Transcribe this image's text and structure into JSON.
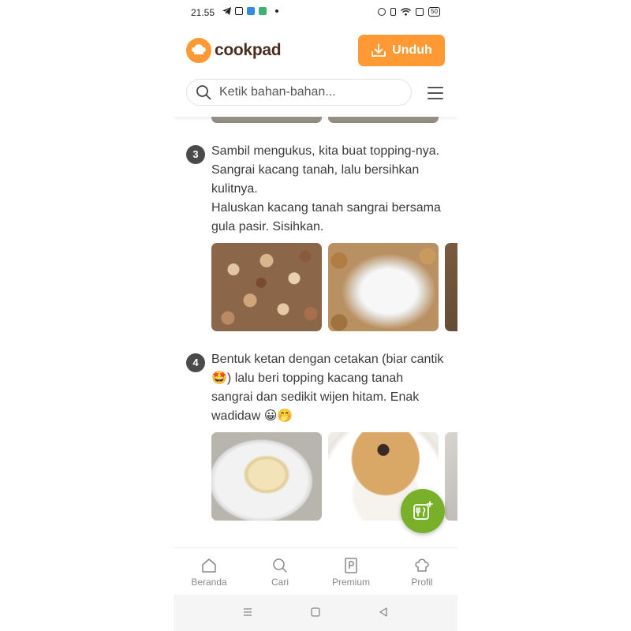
{
  "status_bar": {
    "time": "21.55",
    "battery": "50",
    "left_icons": [
      "telegram-icon",
      "instagram-icon",
      "app-blue-icon",
      "app-green-icon",
      "dot-icon"
    ],
    "right_icons": [
      "alarm-icon",
      "vibrate-icon",
      "wifi-icon",
      "screen-record-icon",
      "battery-icon"
    ]
  },
  "header": {
    "logo_text": "cookpad",
    "download_label": "Unduh",
    "search_placeholder": "Ketik bahan-bahan..."
  },
  "steps": [
    {
      "number": "3",
      "text": "Sambil mengukus, kita buat topping-nya.\nSangrai kacang tanah, lalu bersihkan kulitnya.\nHaluskan kacang tanah sangrai bersama gula pasir. Sisihkan."
    },
    {
      "number": "4",
      "text": "Bentuk ketan dengan cetakan (biar cantik 🤩) lalu beri topping kacang tanah sangrai dan sedikit wijen hitam. Enak wadidaw 😀🤭"
    }
  ],
  "bottom_nav": [
    {
      "label": "Beranda",
      "icon": "home-icon"
    },
    {
      "label": "Cari",
      "icon": "search-icon"
    },
    {
      "label": "Premium",
      "icon": "premium-icon"
    },
    {
      "label": "Profil",
      "icon": "profile-chef-icon"
    }
  ],
  "colors": {
    "brand_orange": "#ff9933",
    "fab_green": "#79b02a",
    "logo_brown": "#4a2d1f"
  }
}
